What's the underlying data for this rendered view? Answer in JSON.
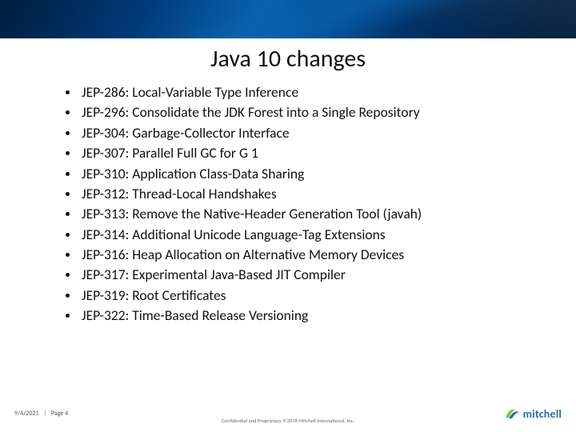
{
  "title": "Java 10 changes",
  "bullets": [
    "JEP-286: Local-Variable Type Inference",
    "JEP-296: Consolidate the JDK Forest into a Single Repository",
    "JEP-304: Garbage-Collector Interface",
    "JEP-307: Parallel Full GC for G 1",
    "JEP-310: Application Class-Data Sharing",
    "JEP-312: Thread-Local Handshakes",
    "JEP-313: Remove the Native-Header Generation Tool (javah)",
    "JEP-314: Additional Unicode Language-Tag Extensions",
    "JEP-316: Heap Allocation on Alternative Memory Devices",
    "JEP-317: Experimental Java-Based JIT Compiler",
    "JEP-319: Root Certificates",
    "JEP-322: Time-Based Release Versioning"
  ],
  "footer": {
    "date": "9/4/2021",
    "page": "Page 4",
    "confidential": "Confidential and Proprietary  ©2018 Mitchell International, Inc.",
    "brand": "mitchell"
  },
  "colors": {
    "brand_blue": "#2b6aa8",
    "brand_green": "#8fbf3f"
  }
}
